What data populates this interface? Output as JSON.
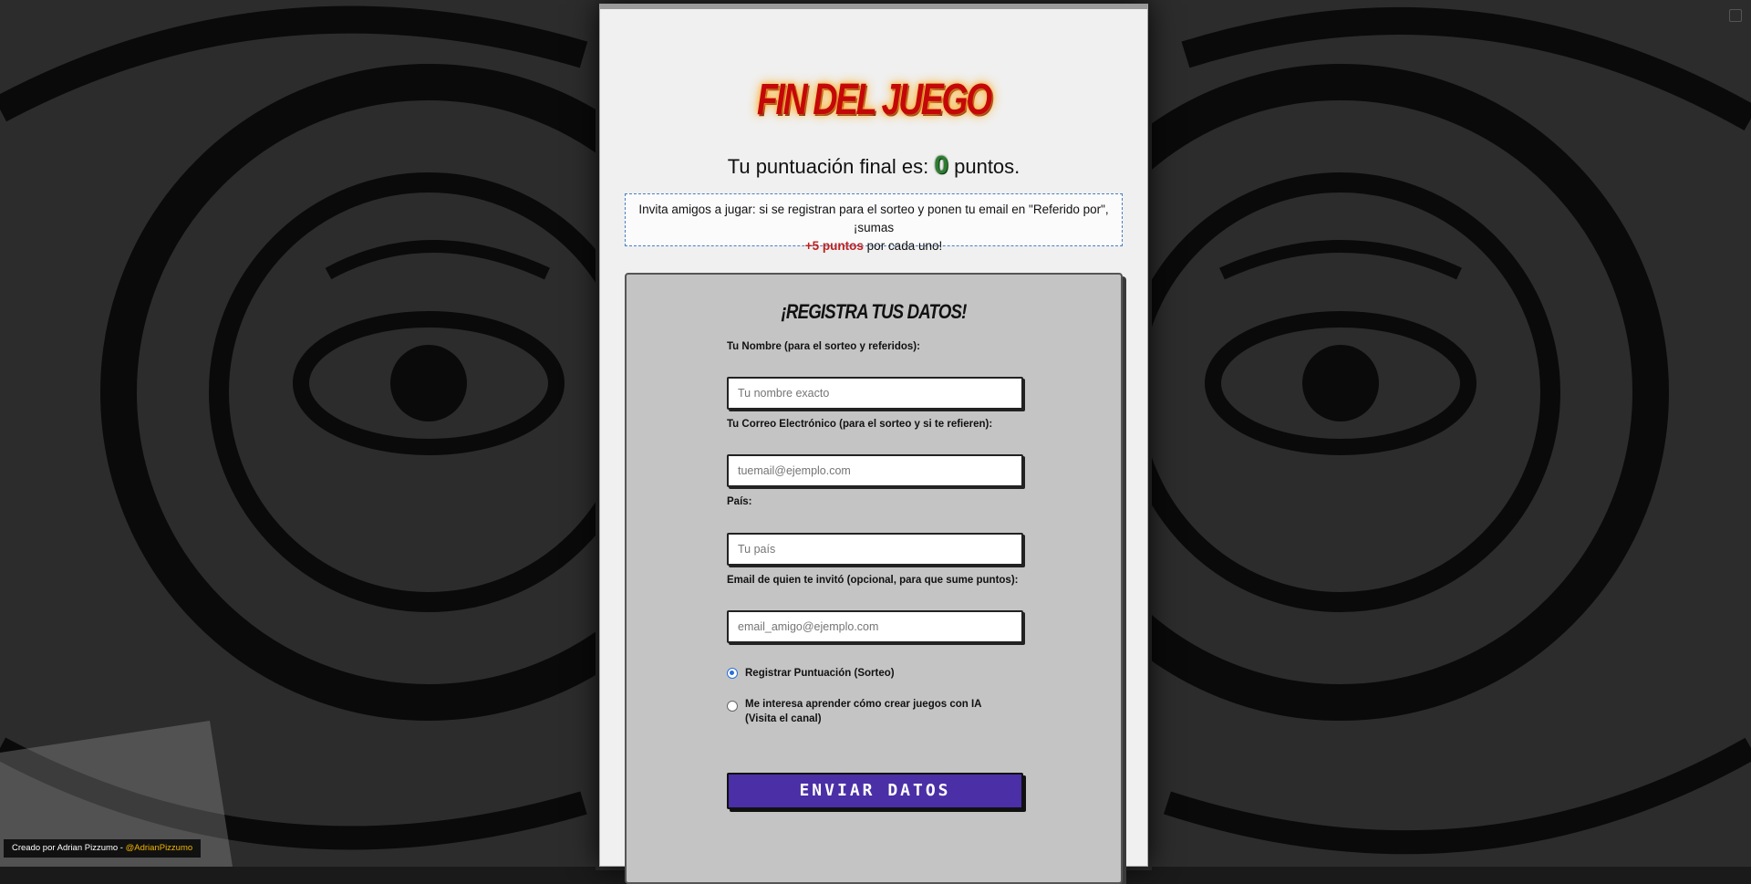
{
  "page": {
    "title": "FIN DEL JUEGO",
    "score": {
      "prefix": "Tu puntuación final es:",
      "value": "0",
      "suffix": "puntos."
    },
    "invite": {
      "text_before": "Invita amigos a jugar: si se registran para el sorteo y ponen tu email en \"Referido por\", ¡sumas",
      "bonus": "+5 puntos",
      "text_after": "por cada uno!"
    },
    "form": {
      "title": "¡REGISTRA TUS DATOS!",
      "fields": [
        {
          "label": "Tu Nombre (para el sorteo y referidos):",
          "placeholder": "Tu nombre exacto",
          "value": ""
        },
        {
          "label": "Tu Correo Electrónico (para el sorteo y si te refieren):",
          "placeholder": "tuemail@ejemplo.com",
          "value": ""
        },
        {
          "label": "País:",
          "placeholder": "Tu país",
          "value": ""
        },
        {
          "label": "Email de quien te invitó (opcional, para que sume puntos):",
          "placeholder": "email_amigo@ejemplo.com",
          "value": ""
        }
      ],
      "options": [
        {
          "label": "Registrar Puntuación (Sorteo)",
          "checked": true
        },
        {
          "label": "Me interesa aprender cómo crear juegos con IA (Visita el canal)",
          "checked": false
        }
      ],
      "submit_label": "ENVIAR DATOS"
    }
  },
  "credit": {
    "text": "Creado por Adrian Pizzumo - ",
    "handle": "@AdrianPizzumo"
  },
  "colors": {
    "title_red": "#c40808",
    "score_green": "#2e7d32",
    "bonus_red": "#c02020",
    "submit_purple": "#4a2fa6",
    "handle_yellow": "#f2b500",
    "radio_blue": "#2a6fdb"
  }
}
